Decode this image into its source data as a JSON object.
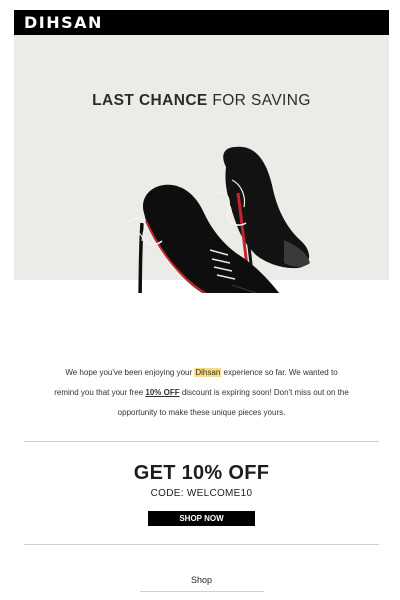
{
  "brand": {
    "name": "DIHSAN"
  },
  "hero": {
    "headline_bold": "LAST CHANCE",
    "headline_rest": " FOR SAVING",
    "image_subject": "black-stiletto-bootie-pair"
  },
  "body": {
    "p1": "We hope you've been enjoying your ",
    "brand_highlight": "Dihsan",
    "p2": " experience so far.  We wanted to remind you that your free  ",
    "discount": "10% OFF",
    "p3": " discount is expiring soon! Don't miss out on the opportunity to make these unique pieces yours."
  },
  "offer": {
    "title": "GET 10% OFF",
    "code": "CODE: WELCOME10",
    "button_label": "SHOP NOW"
  },
  "footer": {
    "shop_link": "Shop"
  },
  "colors": {
    "header_bg": "#000000",
    "hero_bg": "#ecebe7",
    "highlight": "#f8dd86",
    "sole_red": "#c4242b"
  }
}
